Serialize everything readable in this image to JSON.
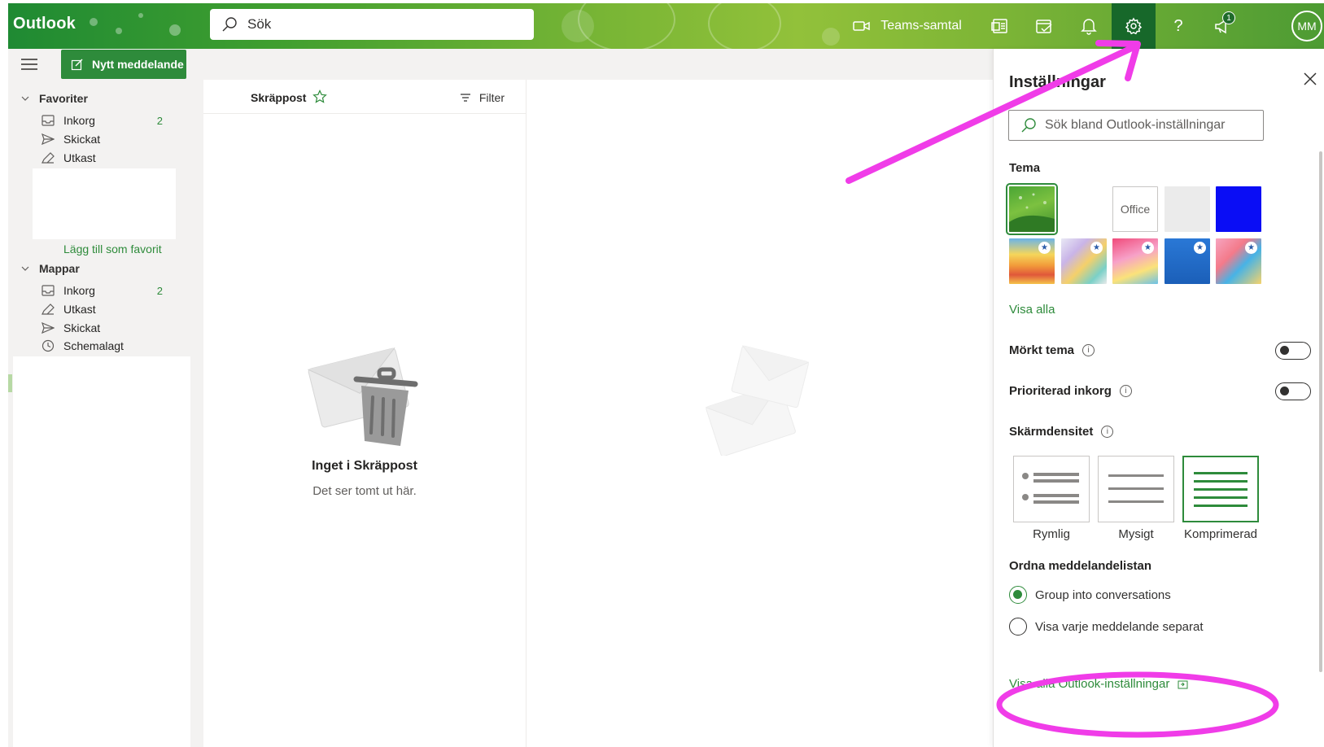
{
  "topbar": {
    "brand": "Outlook",
    "search_placeholder": "Sök",
    "teams_label": "Teams-samtal",
    "notification_count": "1",
    "avatar_initials": "MM"
  },
  "nav": {
    "new_message": "Nytt meddelande",
    "favorites_title": "Favoriter",
    "favorites": [
      {
        "label": "Inkorg",
        "count": "2"
      },
      {
        "label": "Skickat"
      },
      {
        "label": "Utkast"
      }
    ],
    "add_favorite": "Lägg till som favorit",
    "folders_title": "Mappar",
    "folders": [
      {
        "label": "Inkorg",
        "count": "2"
      },
      {
        "label": "Utkast"
      },
      {
        "label": "Skickat"
      },
      {
        "label": "Schemalagt"
      }
    ]
  },
  "list": {
    "folder_title": "Skräppost",
    "filter_label": "Filter",
    "empty_title": "Inget i Skräppost",
    "empty_subtitle": "Det ser tomt ut här."
  },
  "settings": {
    "title": "Inställningar",
    "search_placeholder": "Sök bland Outlook-inställningar",
    "theme_heading": "Tema",
    "office_theme_label": "Office",
    "see_all": "Visa alla",
    "dark_mode": "Mörkt tema",
    "focused_inbox": "Prioriterad inkorg",
    "density_heading": "Skärmdensitet",
    "density_options": [
      "Rymlig",
      "Mysigt",
      "Komprimerad"
    ],
    "sort_heading": "Ordna meddelandelistan",
    "sort_options": [
      "Group into conversations",
      "Visa varje meddelande separat"
    ],
    "view_all_settings": "Visa alla Outlook-inställningar"
  },
  "colors": {
    "accent": "#2e8b3b",
    "annotation": "#f03ce8"
  }
}
